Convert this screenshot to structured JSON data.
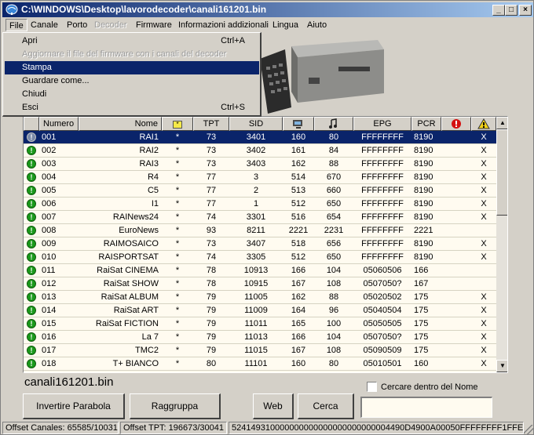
{
  "window": {
    "title": "C:\\WINDOWS\\Desktop\\lavorodecoder\\canali161201.bin",
    "controls": {
      "minimize": "_",
      "maximize": "□",
      "close": "×"
    }
  },
  "menubar": {
    "items": [
      {
        "label": "File",
        "disabled": false
      },
      {
        "label": "Canale",
        "disabled": false
      },
      {
        "label": "Porto",
        "disabled": false
      },
      {
        "label": "Decoder",
        "disabled": true
      },
      {
        "label": "Firmware",
        "disabled": false
      },
      {
        "label": "Informazioni addizionali",
        "disabled": false
      },
      {
        "label": "Lingua",
        "disabled": false
      },
      {
        "label": "Aiuto",
        "disabled": false
      }
    ]
  },
  "file_menu": {
    "items": [
      {
        "label": "Apri",
        "shortcut": "Ctrl+A",
        "disabled": false,
        "selected": false
      },
      {
        "label": "Aggiornare il file del firmware con i canali del decoder",
        "shortcut": "",
        "disabled": true,
        "selected": false
      },
      {
        "label": "Stampa",
        "shortcut": "",
        "disabled": false,
        "selected": true
      },
      {
        "label": "Guardare come...",
        "shortcut": "",
        "disabled": false,
        "selected": false
      },
      {
        "label": "Chiudi",
        "shortcut": "",
        "disabled": false,
        "selected": false
      },
      {
        "label": "Esci",
        "shortcut": "Ctrl+S",
        "disabled": false,
        "selected": false
      }
    ]
  },
  "table": {
    "columns": [
      {
        "key": "numero",
        "label": "Numero"
      },
      {
        "key": "nome",
        "label": "Nome"
      },
      {
        "key": "star",
        "label": "",
        "icon": "star-icon"
      },
      {
        "key": "tpt",
        "label": "TPT"
      },
      {
        "key": "sid",
        "label": "SID"
      },
      {
        "key": "video",
        "label": "",
        "icon": "video-icon"
      },
      {
        "key": "audio",
        "label": "",
        "icon": "audio-icon"
      },
      {
        "key": "epg",
        "label": "EPG"
      },
      {
        "key": "pcr",
        "label": "PCR"
      },
      {
        "key": "alert",
        "label": "",
        "icon": "alert-icon"
      },
      {
        "key": "warning",
        "label": "",
        "icon": "warning-icon"
      }
    ],
    "rows": [
      {
        "numero": "001",
        "nome": "RAI1",
        "star": "*",
        "tpt": "73",
        "sid": "3401",
        "video": "160",
        "audio": "80",
        "epg": "FFFFFFFF",
        "pcr": "8190",
        "warning": "X",
        "selected": true
      },
      {
        "numero": "002",
        "nome": "RAI2",
        "star": "*",
        "tpt": "73",
        "sid": "3402",
        "video": "161",
        "audio": "84",
        "epg": "FFFFFFFF",
        "pcr": "8190",
        "warning": "X"
      },
      {
        "numero": "003",
        "nome": "RAI3",
        "star": "*",
        "tpt": "73",
        "sid": "3403",
        "video": "162",
        "audio": "88",
        "epg": "FFFFFFFF",
        "pcr": "8190",
        "warning": "X"
      },
      {
        "numero": "004",
        "nome": "R4",
        "star": "*",
        "tpt": "77",
        "sid": "3",
        "video": "514",
        "audio": "670",
        "epg": "FFFFFFFF",
        "pcr": "8190",
        "warning": "X"
      },
      {
        "numero": "005",
        "nome": "C5",
        "star": "*",
        "tpt": "77",
        "sid": "2",
        "video": "513",
        "audio": "660",
        "epg": "FFFFFFFF",
        "pcr": "8190",
        "warning": "X"
      },
      {
        "numero": "006",
        "nome": "I1",
        "star": "*",
        "tpt": "77",
        "sid": "1",
        "video": "512",
        "audio": "650",
        "epg": "FFFFFFFF",
        "pcr": "8190",
        "warning": "X"
      },
      {
        "numero": "007",
        "nome": "RAINews24",
        "star": "*",
        "tpt": "74",
        "sid": "3301",
        "video": "516",
        "audio": "654",
        "epg": "FFFFFFFF",
        "pcr": "8190",
        "warning": "X"
      },
      {
        "numero": "008",
        "nome": "EuroNews",
        "star": "*",
        "tpt": "93",
        "sid": "8211",
        "video": "2221",
        "audio": "2231",
        "epg": "FFFFFFFF",
        "pcr": "2221",
        "warning": ""
      },
      {
        "numero": "009",
        "nome": "RAIMOSAICO",
        "star": "*",
        "tpt": "73",
        "sid": "3407",
        "video": "518",
        "audio": "656",
        "epg": "FFFFFFFF",
        "pcr": "8190",
        "warning": "X"
      },
      {
        "numero": "010",
        "nome": "RAISPORTSAT",
        "star": "*",
        "tpt": "74",
        "sid": "3305",
        "video": "512",
        "audio": "650",
        "epg": "FFFFFFFF",
        "pcr": "8190",
        "warning": "X"
      },
      {
        "numero": "011",
        "nome": "RaiSat CINEMA",
        "star": "*",
        "tpt": "78",
        "sid": "10913",
        "video": "166",
        "audio": "104",
        "epg": "05060506",
        "pcr": "166",
        "warning": ""
      },
      {
        "numero": "012",
        "nome": "RaiSat SHOW",
        "star": "*",
        "tpt": "78",
        "sid": "10915",
        "video": "167",
        "audio": "108",
        "epg": "0507050?",
        "pcr": "167",
        "warning": ""
      },
      {
        "numero": "013",
        "nome": "RaiSat ALBUM",
        "star": "*",
        "tpt": "79",
        "sid": "11005",
        "video": "162",
        "audio": "88",
        "epg": "05020502",
        "pcr": "175",
        "warning": "X"
      },
      {
        "numero": "014",
        "nome": "RaiSat ART",
        "star": "*",
        "tpt": "79",
        "sid": "11009",
        "video": "164",
        "audio": "96",
        "epg": "05040504",
        "pcr": "175",
        "warning": "X"
      },
      {
        "numero": "015",
        "nome": "RaiSat FICTION",
        "star": "*",
        "tpt": "79",
        "sid": "11011",
        "video": "165",
        "audio": "100",
        "epg": "05050505",
        "pcr": "175",
        "warning": "X"
      },
      {
        "numero": "016",
        "nome": "La 7",
        "star": "*",
        "tpt": "79",
        "sid": "11013",
        "video": "166",
        "audio": "104",
        "epg": "0507050?",
        "pcr": "175",
        "warning": "X"
      },
      {
        "numero": "017",
        "nome": "TMC2",
        "star": "*",
        "tpt": "79",
        "sid": "11015",
        "video": "167",
        "audio": "108",
        "epg": "05090509",
        "pcr": "175",
        "warning": "X"
      },
      {
        "numero": "018",
        "nome": "T+ BIANCO",
        "star": "*",
        "tpt": "80",
        "sid": "11101",
        "video": "160",
        "audio": "80",
        "epg": "05010501",
        "pcr": "160",
        "warning": "X"
      }
    ]
  },
  "footer": {
    "filename": "canali161201.bin",
    "search_checkbox_label": "Cercare dentro del Nome",
    "search_value": "",
    "buttons": {
      "invert": "Invertire Parabola",
      "group": "Raggruppa",
      "web": "Web",
      "search": "Cerca"
    }
  },
  "statusbar": {
    "offset_canali": "Offset Canales: 65585/10031",
    "offset_tpt": "Offset TPT: 196673/30041",
    "hex": "524149310000000000000000000000004490D4900A00050FFFFFFFF1FFE"
  },
  "colors": {
    "selection": "#0a246a",
    "status_ok": "#1b9a1b",
    "table_bg": "#fffbf0",
    "face": "#d4d0c8"
  }
}
